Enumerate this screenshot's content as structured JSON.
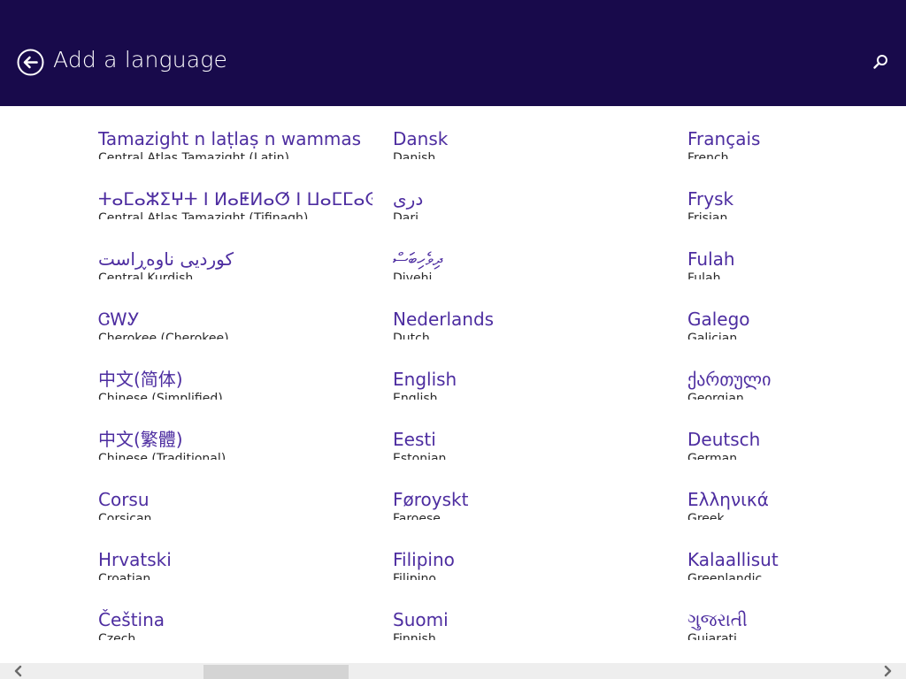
{
  "header": {
    "title": "Add a language",
    "back_icon": "back-arrow-icon",
    "search_icon": "search-icon"
  },
  "colors": {
    "header_bg": "#180a4b",
    "accent": "#4d2da0",
    "text": "#2a2a2a",
    "background": "#ffffff"
  },
  "languages": [
    [
      {
        "native": "Tamazight n laṭlaṣ n wammas",
        "english": "Central Atlas Tamazight (Latin)"
      },
      {
        "native": "ⵜⴰⵎⴰⵣⵉⵖⵜ ⵏ ⵍⴰⵟⵍⴰⵚ ⵏ ⵡⴰⵎⵎⴰⵙ",
        "english": "Central Atlas Tamazight (Tifinagh)"
      },
      {
        "native": "کوردیی ناوەڕاست",
        "english": "Central Kurdish"
      },
      {
        "native": "ᏣᎳᎩ",
        "english": "Cherokee (Cherokee)"
      },
      {
        "native": "中文(简体)",
        "english": "Chinese (Simplified)"
      },
      {
        "native": "中文(繁體)",
        "english": "Chinese (Traditional)"
      },
      {
        "native": "Corsu",
        "english": "Corsican"
      },
      {
        "native": "Hrvatski",
        "english": "Croatian"
      },
      {
        "native": "Čeština",
        "english": "Czech"
      }
    ],
    [
      {
        "native": "Dansk",
        "english": "Danish"
      },
      {
        "native": "دری",
        "english": "Dari"
      },
      {
        "native": "ދިވެހިބަސް",
        "english": "Divehi"
      },
      {
        "native": "Nederlands",
        "english": "Dutch"
      },
      {
        "native": "English",
        "english": "English"
      },
      {
        "native": "Eesti",
        "english": "Estonian"
      },
      {
        "native": "Føroyskt",
        "english": "Faroese"
      },
      {
        "native": "Filipino",
        "english": "Filipino"
      },
      {
        "native": "Suomi",
        "english": "Finnish"
      }
    ],
    [
      {
        "native": "Français",
        "english": "French"
      },
      {
        "native": "Frysk",
        "english": "Frisian"
      },
      {
        "native": "Fulah",
        "english": "Fulah"
      },
      {
        "native": "Galego",
        "english": "Galician"
      },
      {
        "native": "ქართული",
        "english": "Georgian"
      },
      {
        "native": "Deutsch",
        "english": "German"
      },
      {
        "native": "Ελληνικά",
        "english": "Greek"
      },
      {
        "native": "Kalaallisut",
        "english": "Greenlandic"
      },
      {
        "native": "ગુજરાતી",
        "english": "Gujarati"
      }
    ]
  ],
  "scrollbar": {
    "left_icon": "chevron-left-icon",
    "right_icon": "chevron-right-icon",
    "position": 0.22
  }
}
